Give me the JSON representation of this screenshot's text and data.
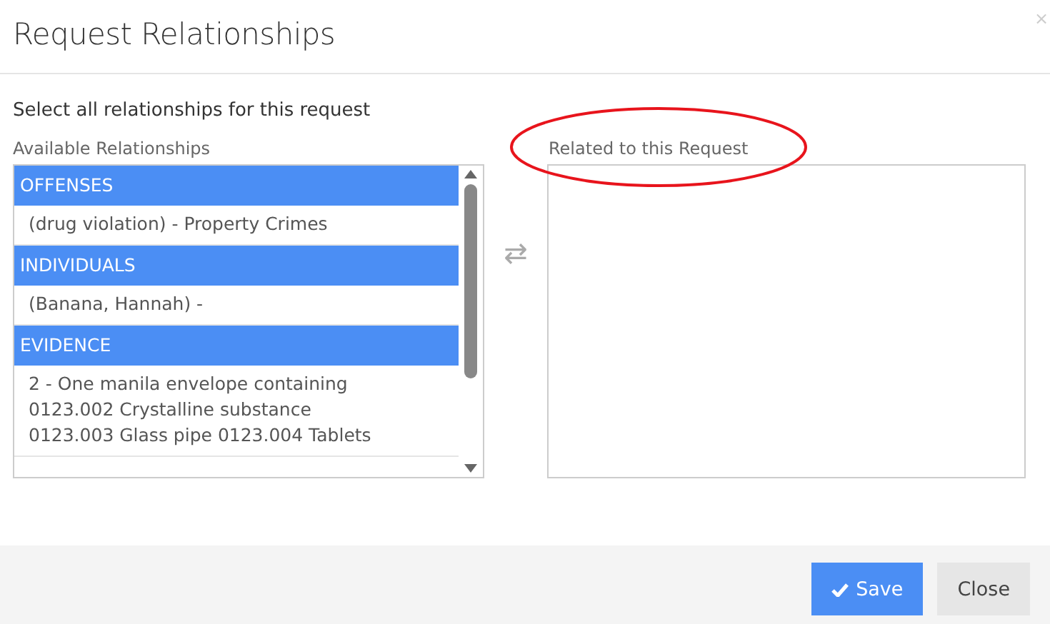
{
  "window": {
    "title": "Request Relationships",
    "close": "×"
  },
  "instruction": "Select all relationships for this request",
  "available": {
    "label": "Available Relationships",
    "entries": [
      {
        "kind": "header",
        "text": "OFFENSES"
      },
      {
        "kind": "item",
        "text": "(drug violation) - Property Crimes"
      },
      {
        "kind": "header",
        "text": "INDIVIDUALS"
      },
      {
        "kind": "item",
        "text": "(Banana, Hannah) -"
      },
      {
        "kind": "header",
        "text": "EVIDENCE"
      },
      {
        "kind": "item",
        "text": "2 - One manila envelope containing 0123.002 Crystalline substance 0123.003 Glass pipe 0123.004 Tablets"
      }
    ]
  },
  "transfer": "⇄",
  "related": {
    "label": "Related to this Request",
    "annotated": true
  },
  "buttons": [
    {
      "kind": "primary",
      "label": "Save"
    },
    {
      "kind": "secondary",
      "label": "Close"
    }
  ]
}
